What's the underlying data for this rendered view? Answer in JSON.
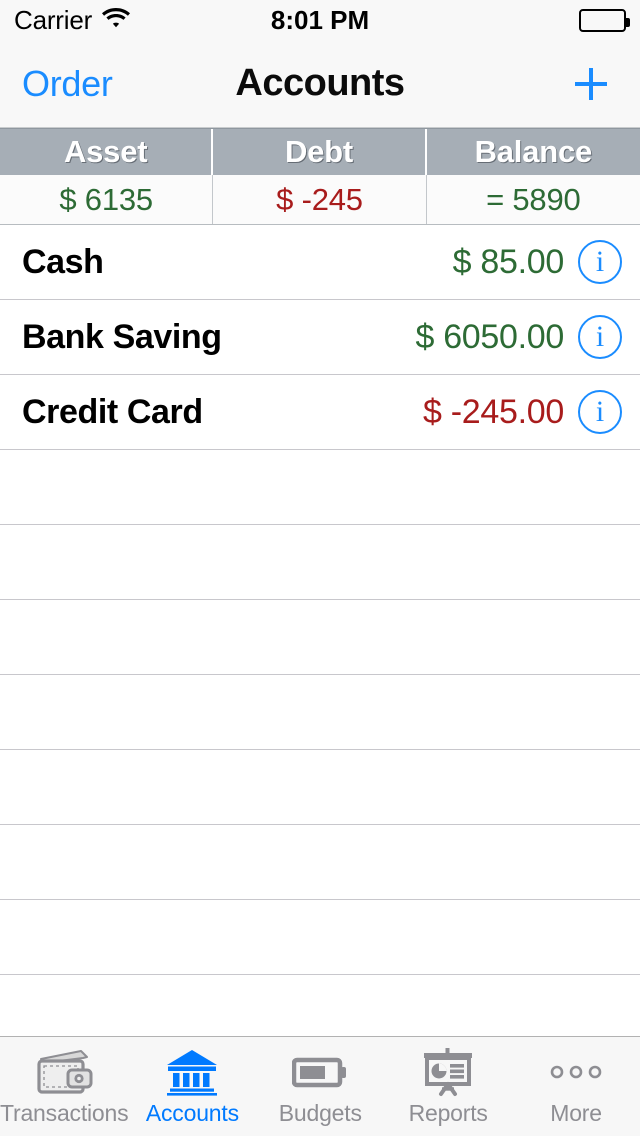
{
  "statusbar": {
    "carrier": "Carrier",
    "wifi_icon": "wifi-icon",
    "time": "8:01 PM",
    "battery_icon": "battery-full-icon"
  },
  "navbar": {
    "back_label": "Order",
    "title": "Accounts",
    "add_icon": "plus-icon",
    "accent_color": "#1a8cff"
  },
  "summary": {
    "columns": [
      {
        "header": "Asset",
        "value": "$ 6135",
        "color": "#2d6b35"
      },
      {
        "header": "Debt",
        "value": "$ -245",
        "color": "#a81c1c"
      },
      {
        "header": "Balance",
        "value": "= 5890",
        "color": "#2d6b35"
      }
    ],
    "header_bg": "#a6aeb6"
  },
  "accounts": [
    {
      "name": "Cash",
      "amount": "$ 85.00",
      "sign": "positive",
      "info_icon": "info-icon"
    },
    {
      "name": "Bank Saving",
      "amount": "$ 6050.00",
      "sign": "positive",
      "info_icon": "info-icon"
    },
    {
      "name": "Credit Card",
      "amount": "$ -245.00",
      "sign": "negative",
      "info_icon": "info-icon"
    }
  ],
  "empty_row_count": 9,
  "tabbar": {
    "active_color": "#007aff",
    "inactive_color": "#8e8e93",
    "items": [
      {
        "label": "Transactions",
        "icon": "wallet-icon",
        "active": false
      },
      {
        "label": "Accounts",
        "icon": "bank-icon",
        "active": true
      },
      {
        "label": "Budgets",
        "icon": "battery-icon",
        "active": false
      },
      {
        "label": "Reports",
        "icon": "presentation-icon",
        "active": false
      },
      {
        "label": "More",
        "icon": "ellipsis-icon",
        "active": false
      }
    ]
  }
}
